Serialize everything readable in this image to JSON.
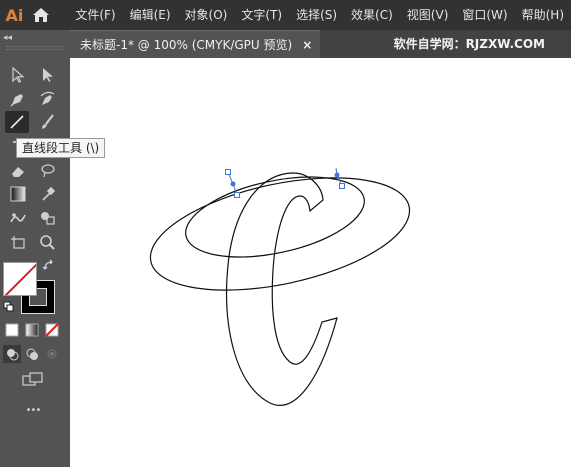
{
  "app": {
    "logo": "Ai",
    "home_icon": "home-icon"
  },
  "menu": [
    {
      "label": "文件(F)"
    },
    {
      "label": "编辑(E)"
    },
    {
      "label": "对象(O)"
    },
    {
      "label": "文字(T)"
    },
    {
      "label": "选择(S)"
    },
    {
      "label": "效果(C)"
    },
    {
      "label": "视图(V)"
    },
    {
      "label": "窗口(W)"
    },
    {
      "label": "帮助(H)"
    }
  ],
  "document_tab": {
    "label": "未标题-1* @ 100% (CMYK/GPU 预览)",
    "close": "×"
  },
  "watermark": "软件自学网：RJZXW.COM",
  "toolbar": {
    "collapse": "◂◂",
    "tooltip": "直线段工具 (\\)",
    "more": "•••",
    "active_tool": "line-segment-tool"
  },
  "colors": {
    "menubar_bg": "#323232",
    "panel_bg": "#535353",
    "logo": "#d9833c",
    "anchor_blue": "#3c78d8",
    "none_red": "#d82020"
  }
}
